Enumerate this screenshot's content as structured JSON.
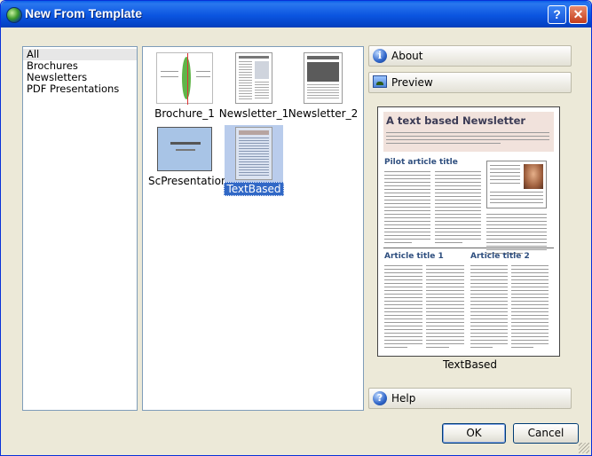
{
  "window": {
    "title": "New From Template"
  },
  "categories": [
    {
      "label": "All",
      "selected": true
    },
    {
      "label": "Brochures"
    },
    {
      "label": "Newsletters"
    },
    {
      "label": "PDF Presentations"
    }
  ],
  "templates": [
    {
      "label": "Brochure_1"
    },
    {
      "label": "Newsletter_1"
    },
    {
      "label": "Newsletter_2"
    },
    {
      "label": "ScPresentation"
    },
    {
      "label": "TextBased",
      "selected": true
    }
  ],
  "side": {
    "about_label": "About",
    "preview_label": "Preview",
    "help_label": "Help"
  },
  "preview": {
    "newsletter_title": "A text based Newsletter",
    "headline_1": "Pilot article title",
    "headline_2": "Article title 1",
    "headline_3": "Article title 2",
    "caption": "TextBased"
  },
  "buttons": {
    "ok": "OK",
    "cancel": "Cancel"
  },
  "colors": {
    "title_bar": "#0a55e0",
    "selection": "#3168c6"
  }
}
